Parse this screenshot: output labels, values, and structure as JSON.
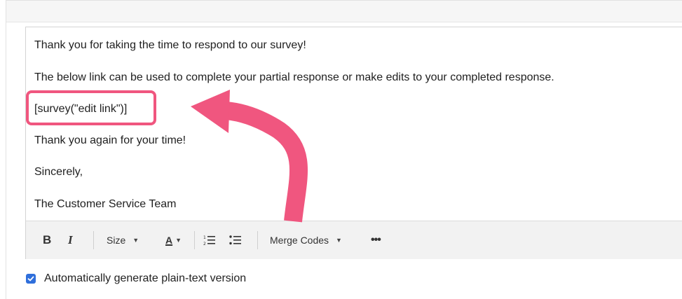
{
  "editor": {
    "lines": [
      "Thank you for taking the time to respond to our survey!",
      "The below link can be used to complete your partial response or make edits to your completed response.",
      "[survey(\"edit link\")]",
      "Thank you again for your time!",
      "Sincerely,",
      "The Customer Service Team"
    ]
  },
  "toolbar": {
    "bold_label": "B",
    "italic_label": "I",
    "size_label": "Size",
    "color_label": "A",
    "merge_codes_label": "Merge Codes",
    "more_label": "•••"
  },
  "options": {
    "auto_plaintext_label": "Automatically generate plain-text version",
    "auto_plaintext_checked": true
  },
  "colors": {
    "highlight": "#f0567f",
    "checkbox": "#2f6fdb"
  }
}
